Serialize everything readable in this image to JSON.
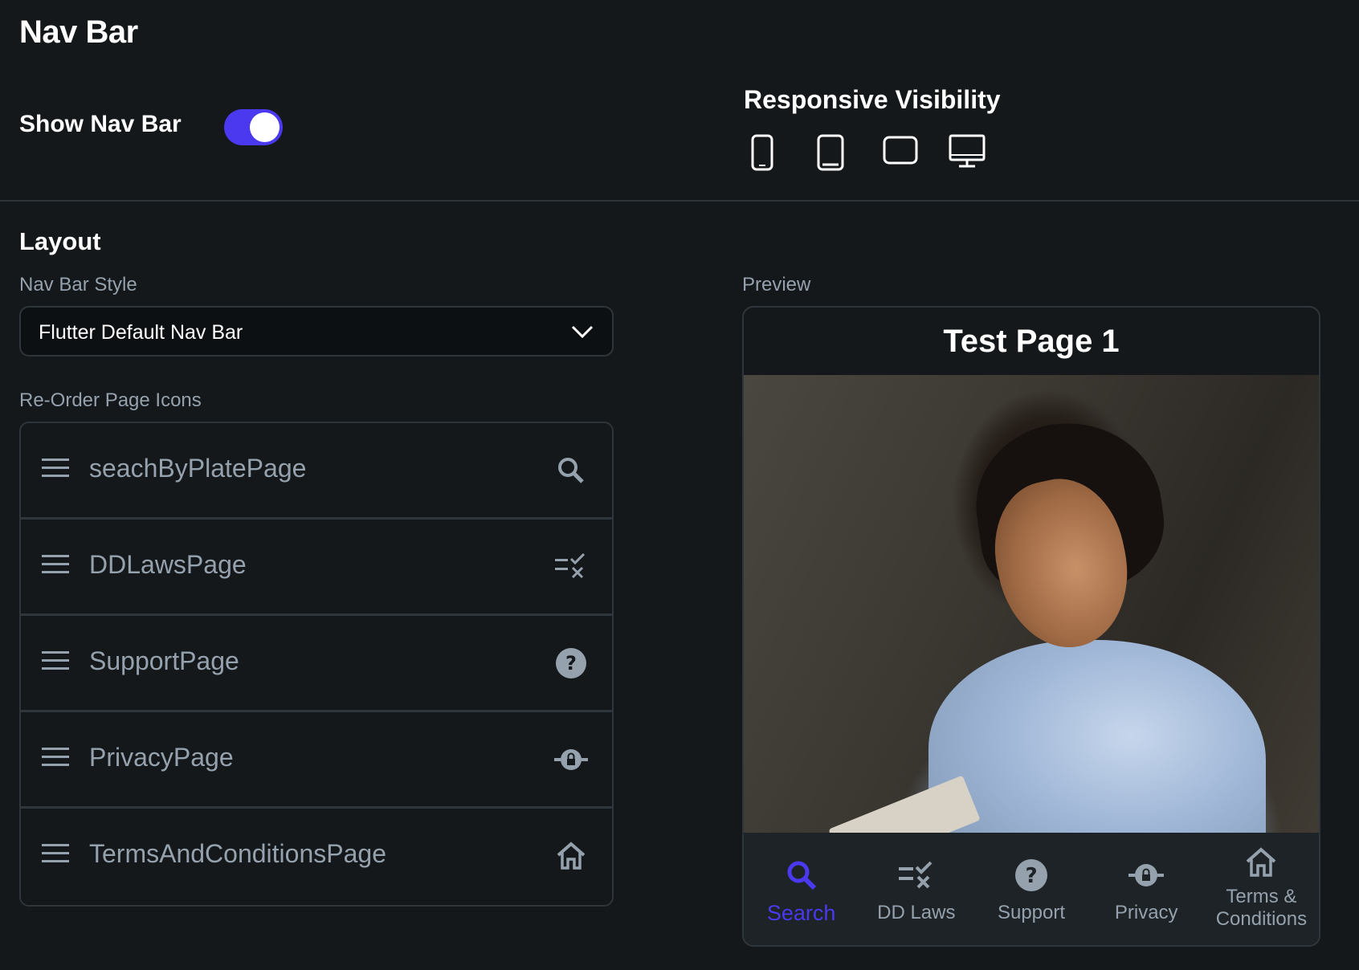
{
  "header": {
    "title": "Nav Bar"
  },
  "show_nav_bar": {
    "label": "Show Nav Bar",
    "enabled": true,
    "accent": "#4b39ef"
  },
  "responsive_visibility": {
    "title": "Responsive Visibility",
    "devices": [
      {
        "icon": "phone-icon"
      },
      {
        "icon": "tablet-icon"
      },
      {
        "icon": "tablet-landscape-icon"
      },
      {
        "icon": "desktop-icon"
      }
    ]
  },
  "layout": {
    "title": "Layout",
    "nav_bar_style": {
      "label": "Nav Bar Style",
      "value": "Flutter Default Nav Bar"
    },
    "reorder": {
      "label": "Re-Order Page Icons",
      "items": [
        {
          "name": "seachByPlatePage",
          "icon": "search-icon"
        },
        {
          "name": "DDLawsPage",
          "icon": "checklist-icon"
        },
        {
          "name": "SupportPage",
          "icon": "help-icon"
        },
        {
          "name": "PrivacyPage",
          "icon": "lock-icon"
        },
        {
          "name": "TermsAndConditionsPage",
          "icon": "home-icon"
        }
      ]
    }
  },
  "preview": {
    "label": "Preview",
    "page_title": "Test Page 1",
    "nav_items": [
      {
        "label": "Search",
        "icon": "search-icon",
        "active": true
      },
      {
        "label": "DD Laws",
        "icon": "checklist-icon",
        "active": false
      },
      {
        "label": "Support",
        "icon": "help-icon",
        "active": false
      },
      {
        "label": "Privacy",
        "icon": "lock-icon",
        "active": false
      },
      {
        "label": "Terms & Conditions",
        "icon": "home-icon",
        "active": false
      }
    ]
  },
  "colors": {
    "background": "#14181b",
    "accent": "#4b39ef",
    "muted_text": "#95a1ac",
    "border": "#2f363b"
  }
}
